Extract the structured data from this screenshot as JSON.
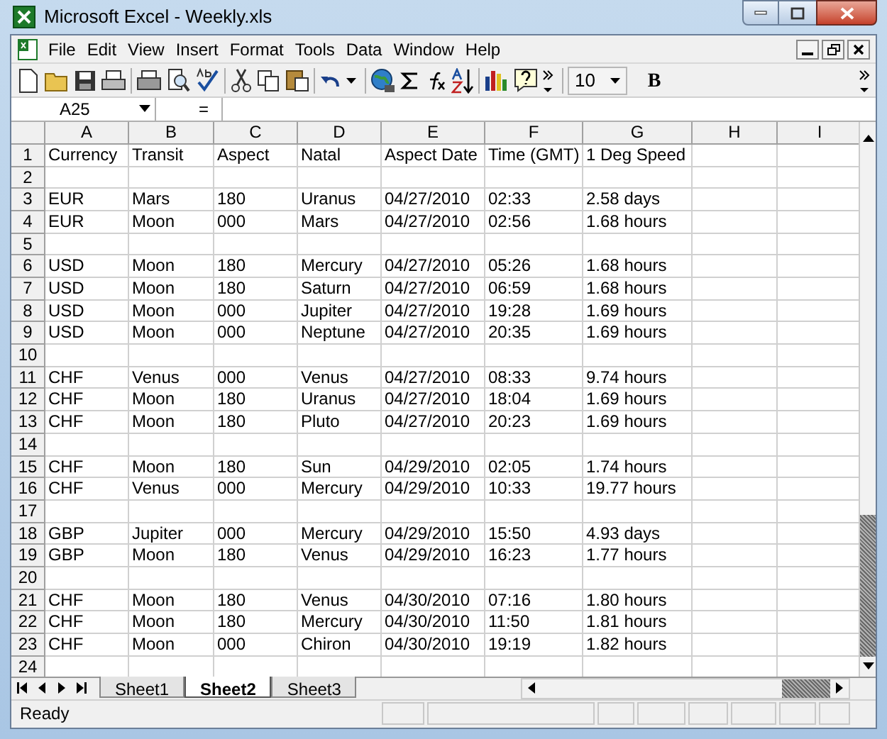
{
  "window": {
    "title": "Microsoft Excel - Weekly.xls"
  },
  "menu": [
    "File",
    "Edit",
    "View",
    "Insert",
    "Format",
    "Tools",
    "Data",
    "Window",
    "Help"
  ],
  "toolbar": {
    "font_size": "10",
    "bold": "B"
  },
  "formula_bar": {
    "name_box": "A25",
    "equals": "="
  },
  "columns": [
    "A",
    "B",
    "C",
    "D",
    "E",
    "F",
    "G",
    "H",
    "I"
  ],
  "rows": [
    {
      "number": "1",
      "cells": [
        "Currency",
        "Transit",
        "Aspect",
        "Natal",
        "Aspect Date",
        "Time (GMT)",
        "1 Deg Speed"
      ]
    },
    {
      "number": "2"
    },
    {
      "number": "3",
      "cells": [
        "EUR",
        "Mars",
        "180",
        "Uranus",
        "04/27/2010",
        "02:33",
        "2.58 days"
      ]
    },
    {
      "number": "4",
      "cells": [
        "EUR",
        "Moon",
        "000",
        "Mars",
        "04/27/2010",
        "02:56",
        "1.68 hours"
      ]
    },
    {
      "number": "5"
    },
    {
      "number": "6",
      "cells": [
        "USD",
        "Moon",
        "180",
        "Mercury",
        "04/27/2010",
        "05:26",
        "1.68 hours"
      ]
    },
    {
      "number": "7",
      "cells": [
        "USD",
        "Moon",
        "180",
        "Saturn",
        "04/27/2010",
        "06:59",
        "1.68 hours"
      ]
    },
    {
      "number": "8",
      "cells": [
        "USD",
        "Moon",
        "000",
        "Jupiter",
        "04/27/2010",
        "19:28",
        "1.69 hours"
      ]
    },
    {
      "number": "9",
      "cells": [
        "USD",
        "Moon",
        "000",
        "Neptune",
        "04/27/2010",
        "20:35",
        "1.69 hours"
      ]
    },
    {
      "number": "10"
    },
    {
      "number": "11",
      "cells": [
        "CHF",
        "Venus",
        "000",
        "Venus",
        "04/27/2010",
        "08:33",
        "9.74 hours"
      ]
    },
    {
      "number": "12",
      "cells": [
        "CHF",
        "Moon",
        "180",
        "Uranus",
        "04/27/2010",
        "18:04",
        "1.69 hours"
      ]
    },
    {
      "number": "13",
      "cells": [
        "CHF",
        "Moon",
        "180",
        "Pluto",
        "04/27/2010",
        "20:23",
        "1.69 hours"
      ]
    },
    {
      "number": "14"
    },
    {
      "number": "15",
      "cells": [
        "CHF",
        "Moon",
        "180",
        "Sun",
        "04/29/2010",
        "02:05",
        "1.74 hours"
      ]
    },
    {
      "number": "16",
      "cells": [
        "CHF",
        "Venus",
        "000",
        "Mercury",
        "04/29/2010",
        "10:33",
        "19.77 hours"
      ]
    },
    {
      "number": "17"
    },
    {
      "number": "18",
      "cells": [
        "GBP",
        "Jupiter",
        "000",
        "Mercury",
        "04/29/2010",
        "15:50",
        "4.93 days"
      ]
    },
    {
      "number": "19",
      "cells": [
        "GBP",
        "Moon",
        "180",
        "Venus",
        "04/29/2010",
        "16:23",
        "1.77 hours"
      ]
    },
    {
      "number": "20"
    },
    {
      "number": "21",
      "cells": [
        "CHF",
        "Moon",
        "180",
        "Venus",
        "04/30/2010",
        "07:16",
        "1.80 hours"
      ]
    },
    {
      "number": "22",
      "cells": [
        "CHF",
        "Moon",
        "180",
        "Mercury",
        "04/30/2010",
        "11:50",
        "1.81 hours"
      ]
    },
    {
      "number": "23",
      "cells": [
        "CHF",
        "Moon",
        "000",
        "Chiron",
        "04/30/2010",
        "19:19",
        "1.82 hours"
      ]
    },
    {
      "number": "24"
    }
  ],
  "sheet_tabs": [
    {
      "label": "Sheet1",
      "selected": false
    },
    {
      "label": "Sheet2",
      "selected": true
    },
    {
      "label": "Sheet3",
      "selected": false
    }
  ],
  "status_bar": {
    "text": "Ready"
  }
}
